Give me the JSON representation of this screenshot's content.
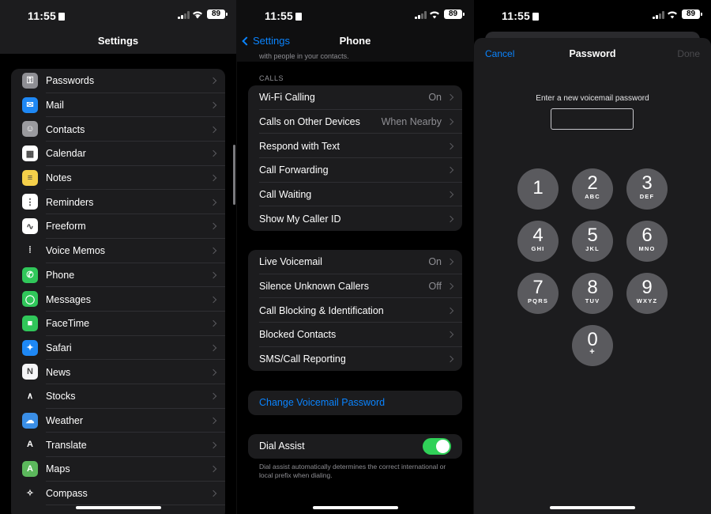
{
  "status": {
    "time": "11:55",
    "battery": "89"
  },
  "settings": {
    "title": "Settings",
    "items": [
      {
        "label": "Passwords",
        "icon": "key-icon",
        "color": "#8e8e93",
        "glyph": "⚿"
      },
      {
        "label": "Mail",
        "icon": "mail-icon",
        "color": "#1e88f5",
        "glyph": "✉"
      },
      {
        "label": "Contacts",
        "icon": "contacts-icon",
        "color": "#9a9a9e",
        "glyph": "☺"
      },
      {
        "label": "Calendar",
        "icon": "calendar-icon",
        "color": "#ffffff",
        "glyph": "▦"
      },
      {
        "label": "Notes",
        "icon": "notes-icon",
        "color": "#f5d04a",
        "glyph": "≡"
      },
      {
        "label": "Reminders",
        "icon": "reminders-icon",
        "color": "#ffffff",
        "glyph": "⋮"
      },
      {
        "label": "Freeform",
        "icon": "freeform-icon",
        "color": "#ffffff",
        "glyph": "∿"
      },
      {
        "label": "Voice Memos",
        "icon": "voice-memos-icon",
        "color": "#1c1c1e",
        "glyph": "⦙"
      },
      {
        "label": "Phone",
        "icon": "phone-icon",
        "color": "#30c75a",
        "glyph": "✆"
      },
      {
        "label": "Messages",
        "icon": "messages-icon",
        "color": "#30c75a",
        "glyph": "◯"
      },
      {
        "label": "FaceTime",
        "icon": "facetime-icon",
        "color": "#30c75a",
        "glyph": "■"
      },
      {
        "label": "Safari",
        "icon": "safari-icon",
        "color": "#1e88f5",
        "glyph": "✦"
      },
      {
        "label": "News",
        "icon": "news-icon",
        "color": "#f5f5f7",
        "glyph": "N"
      },
      {
        "label": "Stocks",
        "icon": "stocks-icon",
        "color": "#1c1c1e",
        "glyph": "∧"
      },
      {
        "label": "Weather",
        "icon": "weather-icon",
        "color": "#3a8ee6",
        "glyph": "☁"
      },
      {
        "label": "Translate",
        "icon": "translate-icon",
        "color": "#1c1c1e",
        "glyph": "A"
      },
      {
        "label": "Maps",
        "icon": "maps-icon",
        "color": "#5cb85c",
        "glyph": "A"
      },
      {
        "label": "Compass",
        "icon": "compass-icon",
        "color": "#1c1c1e",
        "glyph": "✧"
      }
    ]
  },
  "phone": {
    "back_label": "Settings",
    "title": "Phone",
    "top_note": "with people in your contacts.",
    "calls_header": "CALLS",
    "calls": [
      {
        "label": "Wi-Fi Calling",
        "value": "On"
      },
      {
        "label": "Calls on Other Devices",
        "value": "When Nearby"
      },
      {
        "label": "Respond with Text",
        "value": ""
      },
      {
        "label": "Call Forwarding",
        "value": ""
      },
      {
        "label": "Call Waiting",
        "value": ""
      },
      {
        "label": "Show My Caller ID",
        "value": ""
      }
    ],
    "voicemail": [
      {
        "label": "Live Voicemail",
        "value": "On"
      },
      {
        "label": "Silence Unknown Callers",
        "value": "Off"
      },
      {
        "label": "Call Blocking & Identification",
        "value": ""
      },
      {
        "label": "Blocked Contacts",
        "value": ""
      },
      {
        "label": "SMS/Call Reporting",
        "value": ""
      }
    ],
    "change_password": "Change Voicemail Password",
    "dial_assist": {
      "label": "Dial Assist",
      "enabled": true
    },
    "dial_assist_note": "Dial assist automatically determines the correct international or local prefix when dialing."
  },
  "password_sheet": {
    "cancel": "Cancel",
    "title": "Password",
    "done": "Done",
    "prompt": "Enter a new voicemail password",
    "value": "",
    "keys": [
      {
        "digit": "1",
        "letters": ""
      },
      {
        "digit": "2",
        "letters": "ABC"
      },
      {
        "digit": "3",
        "letters": "DEF"
      },
      {
        "digit": "4",
        "letters": "GHI"
      },
      {
        "digit": "5",
        "letters": "JKL"
      },
      {
        "digit": "6",
        "letters": "MNO"
      },
      {
        "digit": "7",
        "letters": "PQRS"
      },
      {
        "digit": "8",
        "letters": "TUV"
      },
      {
        "digit": "9",
        "letters": "WXYZ"
      },
      {
        "digit": "0",
        "letters": "+"
      }
    ]
  }
}
